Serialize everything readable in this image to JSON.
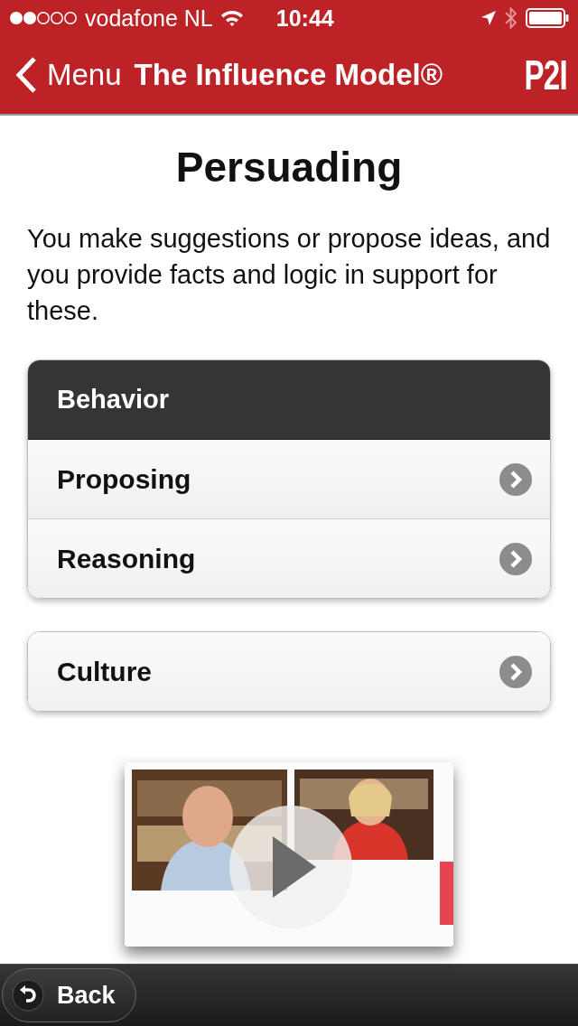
{
  "status_bar": {
    "carrier": "vodafone NL",
    "time": "10:44"
  },
  "nav_bar": {
    "back_label": "Menu",
    "title": "The Influence Model®",
    "logo": "P2I"
  },
  "page": {
    "title": "Persuading",
    "description": "You make suggestions or propose ideas, and you provide facts and logic in support for these."
  },
  "groups": [
    {
      "header": "Behavior",
      "items": [
        {
          "label": "Proposing"
        },
        {
          "label": "Reasoning"
        }
      ]
    },
    {
      "items": [
        {
          "label": "Culture"
        }
      ]
    }
  ],
  "toolbar": {
    "back_button": "Back"
  }
}
